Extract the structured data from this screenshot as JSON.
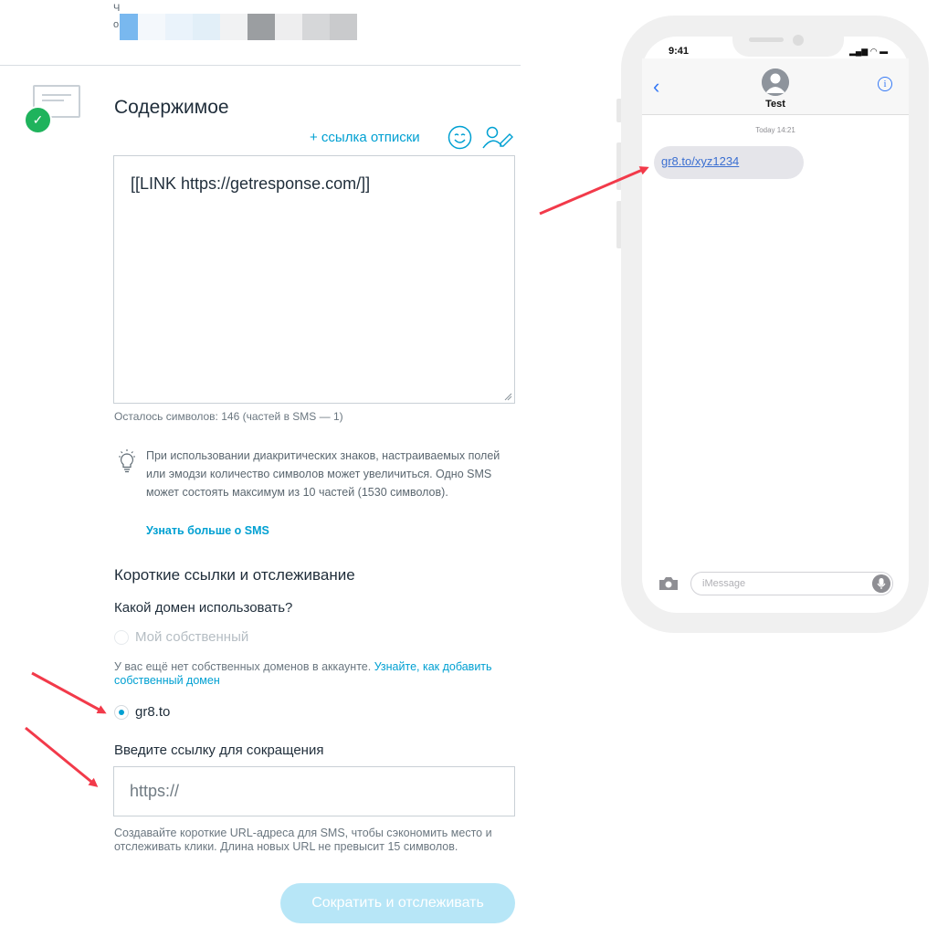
{
  "top_strip": {
    "letters": [
      "Ч",
      "о"
    ],
    "swatches": [
      "#79b8ef",
      "#f4f8fc",
      "#eaf3fb",
      "#e2eff8",
      "#f1f2f3",
      "#9b9ea1",
      "#eeeeef",
      "#d6d7d9",
      "#c9cacc"
    ]
  },
  "content": {
    "title": "Содержимое",
    "unsubscribe_link": "+ ссылка отписки",
    "message_text": "[[LINK https://getresponse.com/]]",
    "chars_left": "Осталось символов: 146 (частей в SMS — 1)",
    "hint_text": "При использовании диакритических знаков, настраиваемых полей или эмодзи количество символов может увеличиться. Одно SMS может состоять максимум из 10 частей (1530 символов).",
    "hint_link": "Узнать больше о SMS"
  },
  "short_links": {
    "title": "Короткие ссылки и отслеживание",
    "domain_question": "Какой домен использовать?",
    "own_domain_label": "Мой собственный",
    "no_domain_text": "У вас ещё нет собственных доменов в аккаунте.",
    "no_domain_link": "Узнайте, как добавить собственный домен",
    "gr8_label": "gr8.to",
    "input_label": "Введите ссылку для сокращения",
    "input_placeholder": "https://",
    "input_value": "",
    "info_text": "Создавайте короткие URL-адреса для SMS, чтобы сэкономить место и отслеживать клики. Длина новых URL не превысит 15 символов.",
    "submit_label": "Сократить и отслеживать"
  },
  "phone": {
    "time": "9:41",
    "status_icons": "▂▄▆ ◠ ▬",
    "contact_name": "Test",
    "info_glyph": "i",
    "back_glyph": "‹",
    "message_date": "Today 14:21",
    "message_link": "gr8.to/xyz1234",
    "imessage_placeholder": "iMessage"
  },
  "colors": {
    "accent": "#00a0d2",
    "success": "#1fb35c",
    "button_disabled": "#b7e6f7",
    "arrow": "#f23a4a",
    "ios_blue": "#3478f6"
  }
}
